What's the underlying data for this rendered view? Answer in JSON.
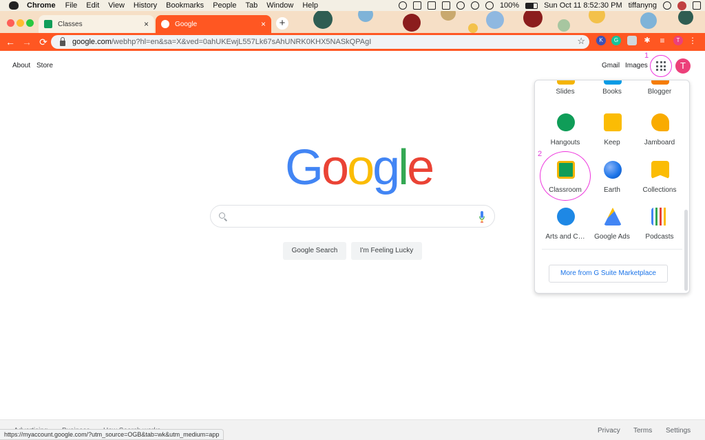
{
  "menubar": {
    "app_name": "Chrome",
    "items": [
      "File",
      "Edit",
      "View",
      "History",
      "Bookmarks",
      "People",
      "Tab",
      "Window",
      "Help"
    ],
    "battery": "100%",
    "datetime": "Sun Oct 11  8:52:30 PM",
    "user": "tiffanyng"
  },
  "tabs": [
    {
      "title": "Classes",
      "close": "×"
    },
    {
      "title": "Google",
      "close": "×"
    }
  ],
  "new_tab": "+",
  "addressbar": {
    "host": "google.com",
    "path": "/webhp?hl=en&sa=X&ved=0ahUKEwjL557Lk67sAhUNRK0KHX5NASkQPAgI",
    "back": "←",
    "forward": "→",
    "reload": "⟳",
    "star": "☆"
  },
  "extensions": [
    {
      "name": "extension-k-icon",
      "color": "#3f51b5",
      "label": "K"
    },
    {
      "name": "extension-grammarly-icon",
      "color": "#15c39a",
      "label": "G"
    },
    {
      "name": "extension-page-icon",
      "color": "#9e9e9e",
      "label": ""
    },
    {
      "name": "extensions-puzzle-icon",
      "color": "#ff5722",
      "label": "✱"
    },
    {
      "name": "reading-list-icon",
      "color": "#ff5722",
      "label": "≡"
    },
    {
      "name": "profile-icon",
      "color": "#ec407a",
      "label": "T"
    },
    {
      "name": "menu-icon",
      "color": "#ff5722",
      "label": "⋮"
    }
  ],
  "header": {
    "about": "About",
    "store": "Store",
    "gmail": "Gmail",
    "images": "Images",
    "avatar_letter": "T"
  },
  "annotations": {
    "apps_marker": "1",
    "classroom_marker": "2"
  },
  "logo": {
    "letters": [
      "G",
      "o",
      "o",
      "g",
      "l",
      "e"
    ],
    "colors": [
      "#4285f4",
      "#ea4335",
      "#fbbc05",
      "#4285f4",
      "#34a853",
      "#ea4335"
    ]
  },
  "search": {
    "google_search": "Google Search",
    "feeling_lucky": "I'm Feeling Lucky"
  },
  "apps_panel": {
    "apps": [
      {
        "label": "Slides",
        "icon": "slides-icon",
        "color": "#f4b400"
      },
      {
        "label": "Books",
        "icon": "books-icon",
        "color": "#039be5"
      },
      {
        "label": "Blogger",
        "icon": "blogger-icon",
        "color": "#f57c00"
      },
      {
        "label": "Hangouts",
        "icon": "hangouts-icon",
        "color": "#0f9d58"
      },
      {
        "label": "Keep",
        "icon": "keep-icon",
        "color": "#fbbc04"
      },
      {
        "label": "Jamboard",
        "icon": "jamboard-icon",
        "color": "#f9ab00"
      },
      {
        "label": "Classroom",
        "icon": "classroom-icon",
        "color": "#0f9d58"
      },
      {
        "label": "Earth",
        "icon": "earth-icon",
        "color": "#1a73e8"
      },
      {
        "label": "Collections",
        "icon": "collections-icon",
        "color": "#fbbc04"
      },
      {
        "label": "Arts and C…",
        "icon": "arts-and-culture-icon",
        "color": "#1e88e5"
      },
      {
        "label": "Google Ads",
        "icon": "google-ads-icon",
        "color": "#4285f4"
      },
      {
        "label": "Podcasts",
        "icon": "podcasts-icon",
        "color": "#34a853"
      }
    ],
    "more_button": "More from G Suite Marketplace"
  },
  "footer": {
    "left": [
      "Advertising",
      "Business",
      "How Search works"
    ],
    "right": [
      "Privacy",
      "Terms",
      "Settings"
    ]
  },
  "status_url": "https://myaccount.google.com/?utm_source=OGB&tab=wk&utm_medium=app"
}
